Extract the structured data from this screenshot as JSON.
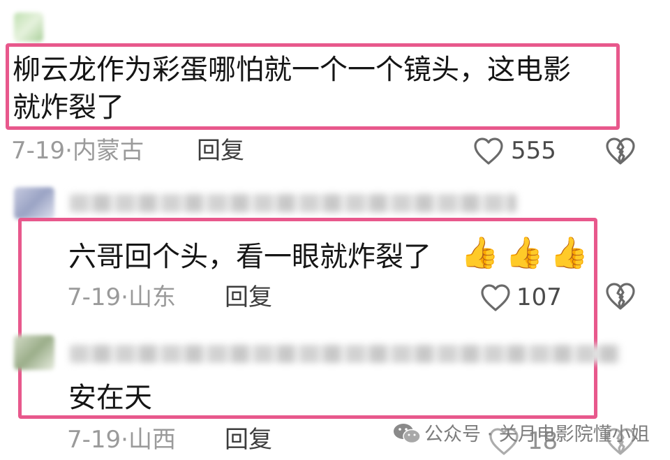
{
  "comments": [
    {
      "text_line1": "柳云龙作为彩蛋哪怕就一个一个镜头，这电影",
      "text_line2": "就炸裂了",
      "date": "7-19",
      "location": "内蒙古",
      "reply_label": "回复",
      "likes": "555",
      "like_icon": "heart-outline-icon",
      "dislike_icon": "broken-heart-icon"
    },
    {
      "text": "六哥回个头，看一眼就炸裂了",
      "emoji": [
        "👍",
        "👍",
        "👍"
      ],
      "date": "7-19",
      "location": "山东",
      "reply_label": "回复",
      "likes": "107",
      "like_icon": "heart-outline-icon",
      "dislike_icon": "broken-heart-icon"
    },
    {
      "text": "安在天",
      "date": "7-19",
      "location": "山西",
      "reply_label": "回复",
      "likes": "18",
      "like_icon": "heart-outline-icon",
      "dislike_icon": "broken-heart-icon"
    }
  ],
  "meta_separator": "·",
  "watermark": {
    "icon": "wechat-icon",
    "text": "公众号 · 关月电影院懂小姐"
  },
  "colors": {
    "highlight_box": "#e8588c",
    "meta_text": "#9a9a9a"
  }
}
